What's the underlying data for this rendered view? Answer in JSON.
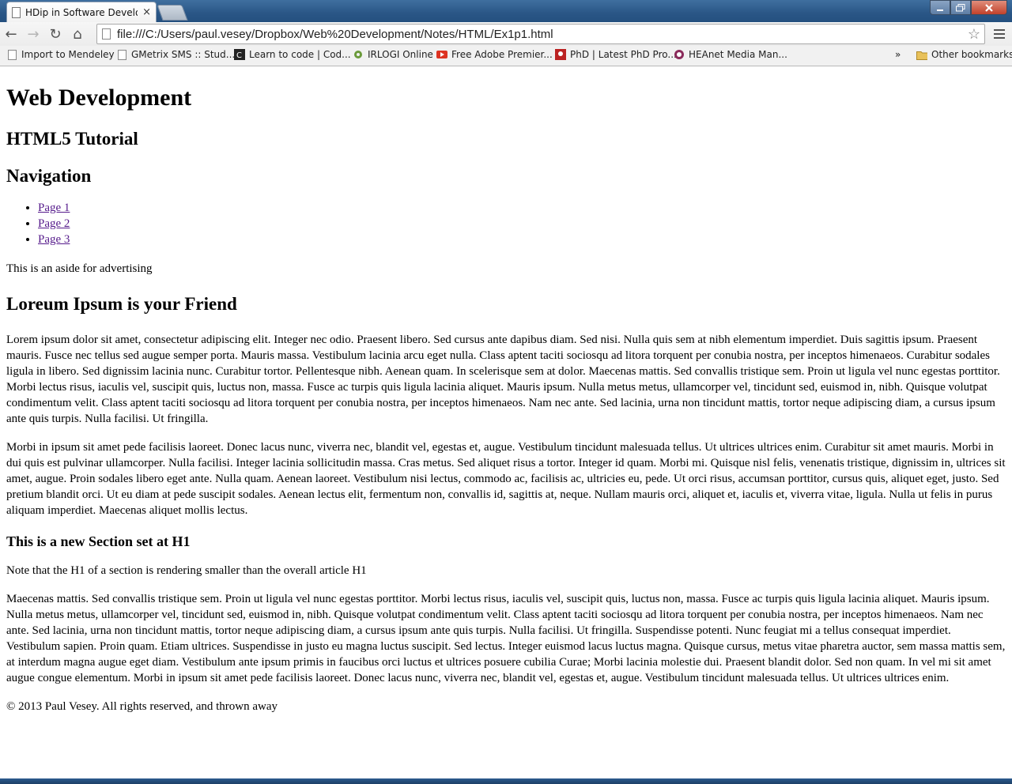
{
  "browser": {
    "tab_title": "HDip in Software Develop",
    "tab_close": "×",
    "back_icon": "←",
    "forward_icon": "→",
    "reload_icon": "↻",
    "home_icon": "⌂",
    "star_icon": "☆",
    "url": "file:///C:/Users/paul.vesey/Dropbox/Web%20Development/Notes/HTML/Ex1p1.html",
    "bookmarks": [
      {
        "label": "Import to Mendeley",
        "icon": "page-icon"
      },
      {
        "label": "GMetrix SMS :: Stud...",
        "icon": "page-icon"
      },
      {
        "label": "Learn to code | Cod...",
        "icon": "codecademy-icon"
      },
      {
        "label": "IRLOGI Online",
        "icon": "gear-icon"
      },
      {
        "label": "Free Adobe Premier...",
        "icon": "youtube-icon"
      },
      {
        "label": "PhD | Latest PhD Pro...",
        "icon": "phd-icon"
      },
      {
        "label": "HEAnet Media Man...",
        "icon": "heanet-icon"
      }
    ],
    "more_bookmarks": "»",
    "other_bookmarks": "Other bookmarks"
  },
  "page": {
    "h1": "Web Development",
    "subtitle": "HTML5 Tutorial",
    "nav_heading": "Navigation",
    "nav_links": [
      "Page 1",
      "Page 2",
      "Page 3"
    ],
    "aside": "This is an aside for advertising",
    "article_heading": "Loreum Ipsum is your Friend",
    "paragraph1": "Lorem ipsum dolor sit amet, consectetur adipiscing elit. Integer nec odio. Praesent libero. Sed cursus ante dapibus diam. Sed nisi. Nulla quis sem at nibh elementum imperdiet. Duis sagittis ipsum. Praesent mauris. Fusce nec tellus sed augue semper porta. Mauris massa. Vestibulum lacinia arcu eget nulla. Class aptent taciti sociosqu ad litora torquent per conubia nostra, per inceptos himenaeos. Curabitur sodales ligula in libero. Sed dignissim lacinia nunc. Curabitur tortor. Pellentesque nibh. Aenean quam. In scelerisque sem at dolor. Maecenas mattis. Sed convallis tristique sem. Proin ut ligula vel nunc egestas porttitor. Morbi lectus risus, iaculis vel, suscipit quis, luctus non, massa. Fusce ac turpis quis ligula lacinia aliquet. Mauris ipsum. Nulla metus metus, ullamcorper vel, tincidunt sed, euismod in, nibh. Quisque volutpat condimentum velit. Class aptent taciti sociosqu ad litora torquent per conubia nostra, per inceptos himenaeos. Nam nec ante. Sed lacinia, urna non tincidunt mattis, tortor neque adipiscing diam, a cursus ipsum ante quis turpis. Nulla facilisi. Ut fringilla.",
    "paragraph2": "Morbi in ipsum sit amet pede facilisis laoreet. Donec lacus nunc, viverra nec, blandit vel, egestas et, augue. Vestibulum tincidunt malesuada tellus. Ut ultrices ultrices enim. Curabitur sit amet mauris. Morbi in dui quis est pulvinar ullamcorper. Nulla facilisi. Integer lacinia sollicitudin massa. Cras metus. Sed aliquet risus a tortor. Integer id quam. Morbi mi. Quisque nisl felis, venenatis tristique, dignissim in, ultrices sit amet, augue. Proin sodales libero eget ante. Nulla quam. Aenean laoreet. Vestibulum nisi lectus, commodo ac, facilisis ac, ultricies eu, pede. Ut orci risus, accumsan porttitor, cursus quis, aliquet eget, justo. Sed pretium blandit orci. Ut eu diam at pede suscipit sodales. Aenean lectus elit, fermentum non, convallis id, sagittis at, neque. Nullam mauris orci, aliquet et, iaculis et, viverra vitae, ligula. Nulla ut felis in purus aliquam imperdiet. Maecenas aliquet mollis lectus.",
    "section_heading": "This is a new Section set at H1",
    "note": "Note that the H1 of a section is rendering smaller than the overall article H1",
    "paragraph3": "Maecenas mattis. Sed convallis tristique sem. Proin ut ligula vel nunc egestas porttitor. Morbi lectus risus, iaculis vel, suscipit quis, luctus non, massa. Fusce ac turpis quis ligula lacinia aliquet. Mauris ipsum. Nulla metus metus, ullamcorper vel, tincidunt sed, euismod in, nibh. Quisque volutpat condimentum velit. Class aptent taciti sociosqu ad litora torquent per conubia nostra, per inceptos himenaeos. Nam nec ante. Sed lacinia, urna non tincidunt mattis, tortor neque adipiscing diam, a cursus ipsum ante quis turpis. Nulla facilisi. Ut fringilla. Suspendisse potenti. Nunc feugiat mi a tellus consequat imperdiet. Vestibulum sapien. Proin quam. Etiam ultrices. Suspendisse in justo eu magna luctus suscipit. Sed lectus. Integer euismod lacus luctus magna. Quisque cursus, metus vitae pharetra auctor, sem massa mattis sem, at interdum magna augue eget diam. Vestibulum ante ipsum primis in faucibus orci luctus et ultrices posuere cubilia Curae; Morbi lacinia molestie dui. Praesent blandit dolor. Sed non quam. In vel mi sit amet augue congue elementum. Morbi in ipsum sit amet pede facilisis laoreet. Donec lacus nunc, viverra nec, blandit vel, egestas et, augue. Vestibulum tincidunt malesuada tellus. Ut ultrices ultrices enim.",
    "footer": "© 2013 Paul Vesey. All rights reserved, and thrown away"
  },
  "colors": {
    "visited_link": "#551a8b",
    "titlebar": "#2a5686"
  }
}
